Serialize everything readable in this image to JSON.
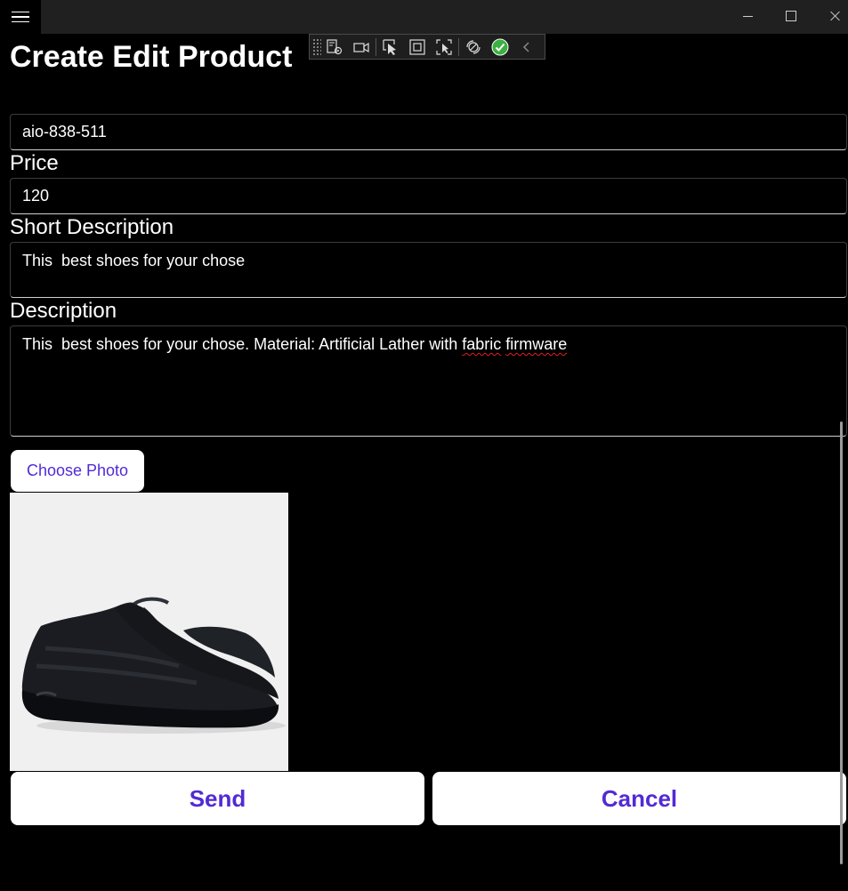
{
  "window": {
    "menu_icon": "hamburger-icon",
    "controls": [
      "minimize-icon",
      "maximize-icon",
      "close-icon"
    ]
  },
  "page": {
    "title": "Create Edit Product"
  },
  "devtoolbar": {
    "icons": [
      "live-visual-tree-icon",
      "record-icon",
      "select-element-icon",
      "display-layout-adorners-icon",
      "track-focus-icon",
      "hot-reload-icon",
      "status-ok-icon",
      "collapse-icon"
    ]
  },
  "form": {
    "name_value": "aio-838-511",
    "price_label": "Price",
    "price_value": "120",
    "short_description_label": "Short Description",
    "short_description_value": "This  best shoes for your chose",
    "description_label": "Description",
    "description_text_plain": "This  best shoes for your chose. Material: Artificial Lather with ",
    "description_misspelled_1": "fabric",
    "description_misspelled_2": "firmware",
    "choose_photo_label": "Choose Photo"
  },
  "actions": {
    "send_label": "Send",
    "cancel_label": "Cancel"
  },
  "colors": {
    "accent": "#512bd4",
    "background": "#000000",
    "spellcheck": "#e02020",
    "status_ok": "#3cb043"
  }
}
